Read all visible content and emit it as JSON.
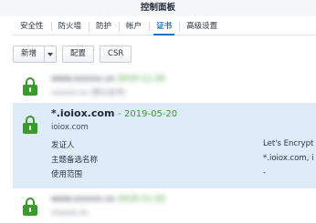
{
  "window": {
    "title": "控制面板"
  },
  "tabs": [
    {
      "label": "安全性"
    },
    {
      "label": "防火墙"
    },
    {
      "label": "防护"
    },
    {
      "label": "帐户"
    },
    {
      "label": "证书",
      "active": true
    },
    {
      "label": "高级设置"
    }
  ],
  "toolbar": {
    "add_label": "新增",
    "config_label": "配置",
    "csr_label": "CSR"
  },
  "certificates": [
    {
      "name": "www.xxxxxx.xx",
      "date": "2019-11-20",
      "sub": "xxxxxx.xx (默认证书)",
      "blurred": true
    },
    {
      "name": "*.ioiox.com",
      "date_text": "- 2019-05-20",
      "domain": "ioiox.com",
      "details": [
        {
          "key": "发证人",
          "value": "Let's Encrypt"
        },
        {
          "key": "主题备选名称",
          "value": "*.ioiox.com, i"
        },
        {
          "key": "使用范围",
          "value": "-"
        }
      ]
    },
    {
      "name": "www.xxxxxx.xx",
      "date": "2019-11-20",
      "sub": "xxxxxx.xx",
      "blurred": true
    }
  ],
  "colors": {
    "accent": "#1a73c8",
    "lock_green": "#3a9a2e",
    "selected_row": "#deebf9"
  },
  "icons": {
    "lock": "lock-icon",
    "dropdown": "chevron-down-icon"
  }
}
